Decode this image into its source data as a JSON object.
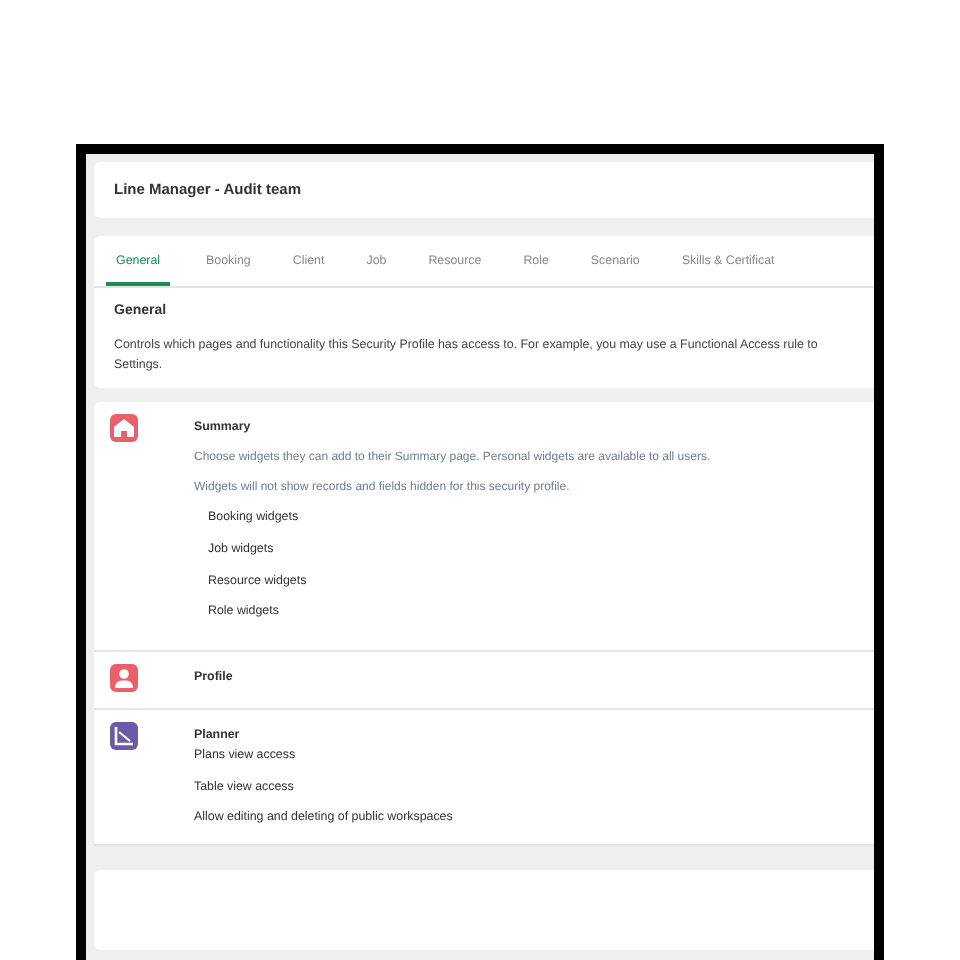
{
  "header": {
    "title": "Line Manager - Audit team"
  },
  "tabs": [
    {
      "label": "General",
      "selected": true
    },
    {
      "label": "Booking",
      "selected": false
    },
    {
      "label": "Client",
      "selected": false
    },
    {
      "label": "Job",
      "selected": false
    },
    {
      "label": "Resource",
      "selected": false
    },
    {
      "label": "Role",
      "selected": false
    },
    {
      "label": "Scenario",
      "selected": false
    },
    {
      "label": "Skills & Certificat",
      "selected": false
    }
  ],
  "general": {
    "heading": "General",
    "description": [
      "Controls which pages and functionality this Security Profile has access to. For example, you may use a Functional Access rule to",
      "Settings."
    ]
  },
  "sections": [
    {
      "kind": "home",
      "color": "#e8606a",
      "title": "Summary",
      "notes": [
        "Choose widgets they can add to their Summary page. Personal widgets are available to all users.",
        "Widgets will not show records and fields hidden for this security profile."
      ],
      "items": [
        "Booking widgets",
        "Job widgets",
        "Resource widgets",
        "Role widgets"
      ]
    },
    {
      "kind": "profile",
      "color": "#e8606a",
      "title": "Profile"
    },
    {
      "kind": "planner",
      "color": "#6a5aa8",
      "title": "Planner",
      "items": [
        "Plans view access",
        "Table view access",
        "Allow editing and deleting of public workspaces"
      ]
    }
  ]
}
